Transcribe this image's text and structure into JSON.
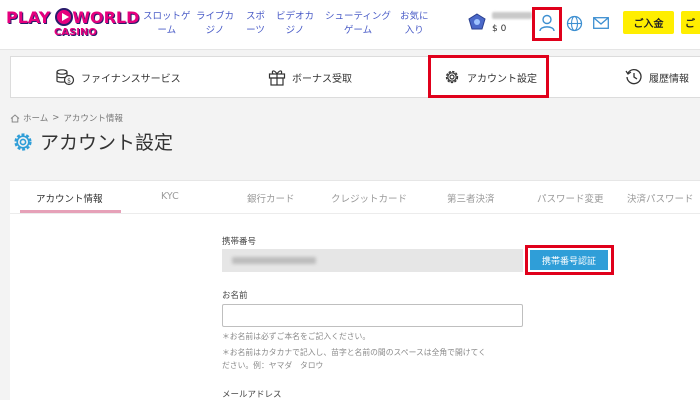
{
  "header": {
    "logo_top_left": "PLAY",
    "logo_top_right": "WORLD",
    "logo_bottom": "CASINO",
    "nav": [
      {
        "label": "スロットゲ\nーム"
      },
      {
        "label": "ライブカ\nジノ"
      },
      {
        "label": "スポ\nーツ"
      },
      {
        "label": "ビデオカ\nジノ"
      },
      {
        "label": "シューティング\nゲーム"
      },
      {
        "label": "お気に\n入り"
      }
    ],
    "balance": "$ 0",
    "deposit_label": "ご入金",
    "deposit_label_2": "ご"
  },
  "main_tabs": [
    {
      "label": "ファイナンスサービス"
    },
    {
      "label": "ボーナス受取"
    },
    {
      "label": "アカウント設定"
    },
    {
      "label": "履歴情報"
    }
  ],
  "breadcrumb": {
    "home": "ホーム",
    "separator": ">",
    "current": "アカウント情報"
  },
  "page_title": "アカウント設定",
  "sub_tabs": [
    {
      "label": "アカウント情報"
    },
    {
      "label": "KYC"
    },
    {
      "label": "銀行カード"
    },
    {
      "label": "クレジットカード"
    },
    {
      "label": "第三者決済"
    },
    {
      "label": "パスワード変更"
    },
    {
      "label": "決済パスワード"
    }
  ],
  "form": {
    "phone_label": "携帯番号",
    "verify_button": "携帯番号認証",
    "name_label": "お名前",
    "name_note_1": "＊お名前は必ずご本名をご記入ください。",
    "name_note_2": "＊お名前はカタカナで記入し、苗字と名前の間のスペースは全角で開けてく",
    "name_note_3": "ださい。例：ヤマダ　タロウ",
    "email_label": "メールアドレス"
  },
  "colors": {
    "accent_blue": "#2f9ed8",
    "deposit_yellow": "#ffee00",
    "highlight_red": "#e0001b",
    "nav_link": "#4a5cc7"
  }
}
